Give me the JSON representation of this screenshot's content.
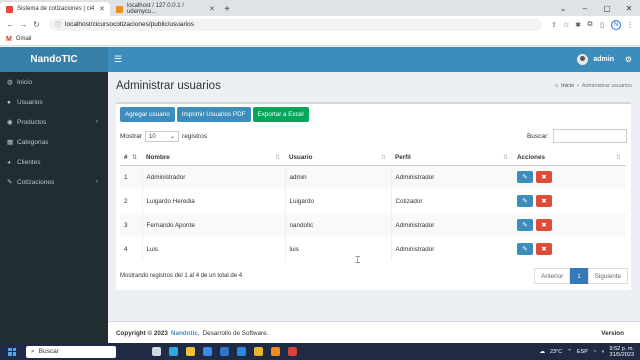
{
  "browser": {
    "tabs": [
      {
        "title": "Sistema de cotizaciones | ci4",
        "active": true,
        "favicon_color": "#e8453c"
      },
      {
        "title": "localhost / 127.0.0.1 / udemycu...",
        "active": false,
        "favicon_color": "#f29111"
      }
    ],
    "url": "localhost/cicursocotizaciones/public/usuarios",
    "bookmark": "Gmail",
    "profile_initial": "N"
  },
  "app": {
    "brand": "NandoTIC",
    "user": "admin"
  },
  "sidebar": {
    "items": [
      {
        "label": "Inicio",
        "icon": "dashboard-icon",
        "glyph": "◍",
        "has_chevron": false
      },
      {
        "label": "Usuarios",
        "icon": "user-icon",
        "glyph": "●",
        "has_chevron": false
      },
      {
        "label": "Productos",
        "icon": "product-icon",
        "glyph": "◉",
        "has_chevron": true
      },
      {
        "label": "Categorias",
        "icon": "tags-icon",
        "glyph": "▦",
        "has_chevron": false
      },
      {
        "label": "Clientes",
        "icon": "users-icon",
        "glyph": "◕",
        "has_chevron": false
      },
      {
        "label": "Cotizaciones",
        "icon": "edit-icon",
        "glyph": "✎",
        "has_chevron": true
      }
    ]
  },
  "page": {
    "title": "Administrar usuarios",
    "breadcrumb": {
      "home": "Inicio",
      "current": "Administrar usuarios"
    }
  },
  "toolbar": {
    "add_label": "Agregar usuario",
    "pdf_label": "Imprimir Usuarios PDF",
    "excel_label": "Exportar a Excel"
  },
  "datatable": {
    "show_label": "Mostrar",
    "length_value": "10",
    "records_label": "registros",
    "search_label": "Buscar:",
    "search_value": "",
    "columns": [
      "#",
      "Nombre",
      "Usuario",
      "Perfil",
      "Acciones"
    ],
    "rows": [
      {
        "id": "1",
        "nombre": "Administrador",
        "usuario": "admin",
        "perfil": "Administrador"
      },
      {
        "id": "2",
        "nombre": "Luigardo Heredia",
        "usuario": "Luigardo",
        "perfil": "Cotizador"
      },
      {
        "id": "3",
        "nombre": "Fernando Aponte",
        "usuario": "nandotic",
        "perfil": "Administrador"
      },
      {
        "id": "4",
        "nombre": "Luis",
        "usuario": "luis",
        "perfil": "Administrador"
      }
    ],
    "info": "Mostrando registros del 1 al 4 de un total de 4",
    "pager": {
      "prev": "Anterior",
      "current": "1",
      "next": "Siguiente"
    }
  },
  "footer": {
    "copyright": "Copyright © 2023",
    "brand": "Nandotic.",
    "text": "Desarrollo de Software.",
    "version": "Version"
  },
  "taskbar": {
    "search_placeholder": "Buscar",
    "weather": "23°C",
    "lang": "ESP",
    "time": "9:52 p. m.",
    "date": "31/5/2023"
  },
  "colors": {
    "header": "#3c8dbc",
    "brand_bg": "#367fa9",
    "sidebar": "#222d32",
    "success": "#00a65a",
    "danger": "#dd4b39"
  }
}
